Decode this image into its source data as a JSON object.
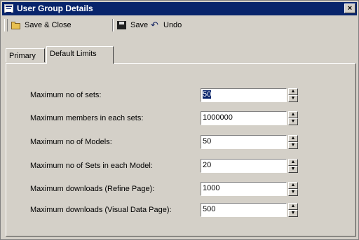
{
  "window": {
    "title": "User Group Details",
    "close_glyph": "×"
  },
  "toolbar": {
    "save_close": {
      "label": "Save & Close",
      "icon": "folder-icon"
    },
    "save": {
      "label": "Save",
      "icon": "disk-icon"
    },
    "undo": {
      "label": "Undo",
      "icon": "undo-arrow-icon"
    }
  },
  "tabs": [
    {
      "label": "Primary",
      "active": false
    },
    {
      "label": "Default Limits",
      "active": true
    }
  ],
  "limits": [
    {
      "label": "Maximum no of sets:",
      "value": "50"
    },
    {
      "label": "Maximum members in each sets:",
      "value": "1000000"
    },
    {
      "label": "Maximum no of Models:",
      "value": "50"
    },
    {
      "label": "Maximum no of Sets in each Model:",
      "value": "20"
    },
    {
      "label": "Maximum downloads (Refine Page):",
      "value": "1000"
    },
    {
      "label": "Maximum downloads (Visual Data Page):",
      "value": "500"
    }
  ],
  "colors": {
    "titlebar": "#08246b",
    "face": "#d4d0c8",
    "selection": "#08246b"
  }
}
